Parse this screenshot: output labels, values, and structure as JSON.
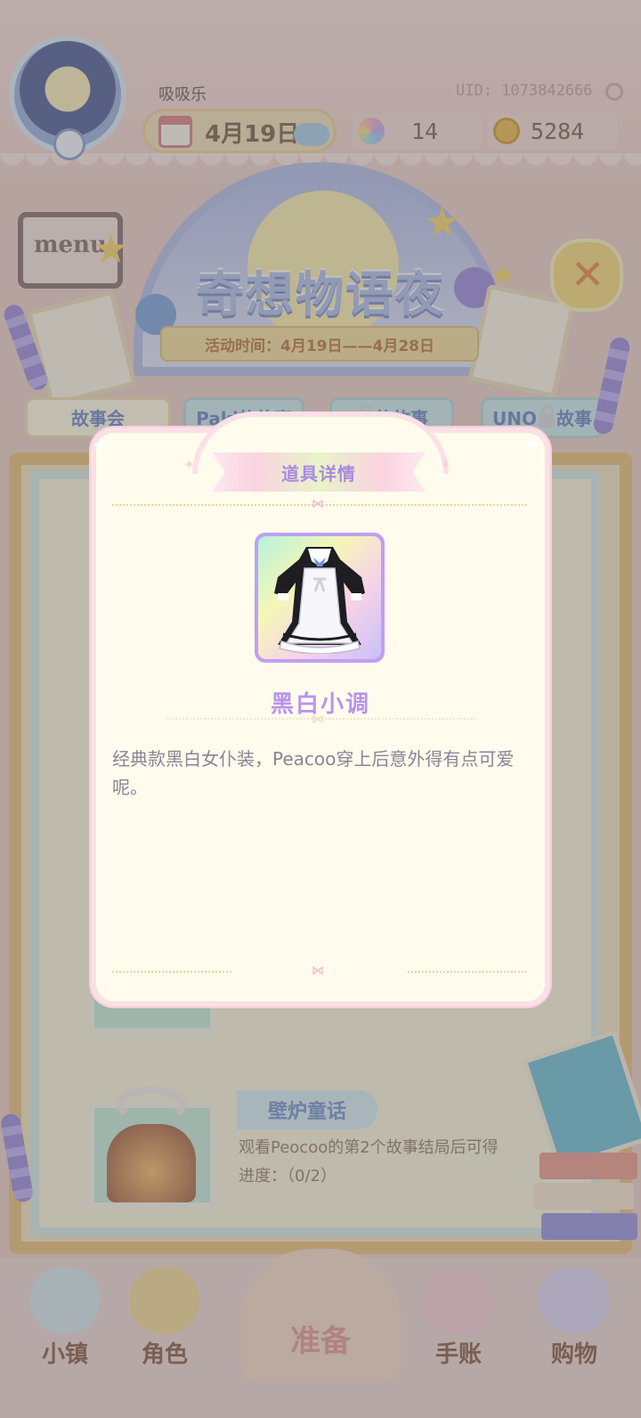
{
  "header": {
    "username": "吸吸乐",
    "uid": "UID: 1073842666",
    "date": "4月19日",
    "gems": "14",
    "coins": "5284"
  },
  "event": {
    "title": "奇想物语夜",
    "time": "活动时间：4月19日——4月28日",
    "menu_label": "menu"
  },
  "tabs": [
    {
      "label": "故事会",
      "locked": false
    },
    {
      "label": "Paki的故事",
      "locked": false
    },
    {
      "label": "的故事",
      "locked": true
    },
    {
      "label": "UNO",
      "suffix": "故事",
      "locked": true
    }
  ],
  "story": {
    "title": "壁炉童话",
    "description": "观看Peocoo的第2个故事结局后可得",
    "progress": "进度：（0/2）"
  },
  "bottom_nav": [
    {
      "label": "小镇",
      "icon": "map-icon"
    },
    {
      "label": "角色",
      "icon": "character-icon"
    },
    {
      "label": "准备",
      "icon": "wardrobe-icon"
    },
    {
      "label": "手账",
      "icon": "journal-icon"
    },
    {
      "label": "购物",
      "icon": "shopping-bag-icon"
    }
  ],
  "modal": {
    "title": "道具详情",
    "item_name": "黑白小调",
    "item_description": "经典款黑白女仆装，Peacoo穿上后意外得有点可爱呢。",
    "item_icon": "maid-dress-icon"
  },
  "colors": {
    "modal_bg": "#fffcee",
    "modal_border": "#fbe0e6",
    "item_name": "#b994ec",
    "title_text": "#a88be0"
  }
}
